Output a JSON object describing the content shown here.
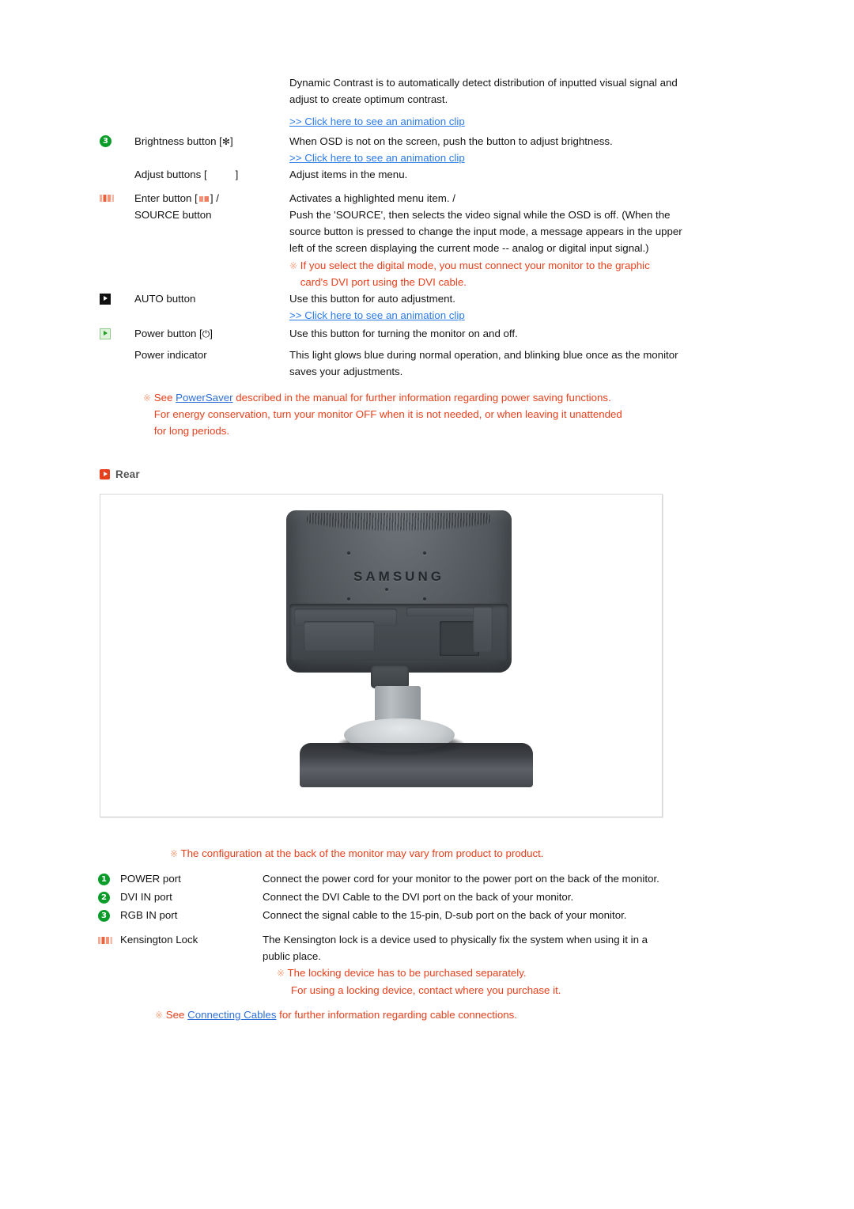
{
  "front_controls": {
    "dynamic_contrast_desc": "Dynamic Contrast is to automatically detect distribution of inputted visual signal and adjust to create optimum contrast.",
    "animation_link": ">> Click here to see an animation clip",
    "rows": [
      {
        "badge": "3",
        "badge_type": "green-circle",
        "name_prefix": "Brightness button [",
        "name_glyph": "✻",
        "name_suffix": "]",
        "desc": "When OSD is not on the screen, push the button to adjust brightness.",
        "link": ">> Click here to see an animation clip"
      },
      {
        "badge": "",
        "badge_type": "none",
        "name_prefix": "Adjust buttons [",
        "name_glyph": "",
        "name_suffix": "]",
        "desc": "Adjust items in the menu.",
        "link": ""
      },
      {
        "badge": "",
        "badge_type": "tiny-red",
        "name_prefix": "Enter button [",
        "name_glyph": "",
        "name_suffix": "] /",
        "name_line2": "SOURCE button",
        "desc": "Activates a highlighted menu item. /",
        "desc2": "Push the 'SOURCE', then selects the video signal while the OSD is off. (When the source button is pressed to change the input mode, a message appears in the upper left of the screen displaying the current mode -- analog or digital input signal.)",
        "note": "If you select the digital mode, you must connect your monitor to the graphic card's DVI port using the DVI cable.",
        "link": ""
      },
      {
        "badge": "",
        "badge_type": "black-square",
        "name_prefix": "AUTO button",
        "name_glyph": "",
        "name_suffix": "",
        "desc": "Use this button for auto adjustment.",
        "link": ">> Click here to see an animation clip"
      },
      {
        "badge": "",
        "badge_type": "green-square",
        "name_prefix": "Power button [",
        "name_glyph": "⏻",
        "name_suffix": "]",
        "desc": "Use this button for turning the monitor on and off.",
        "link": ""
      },
      {
        "badge": "",
        "badge_type": "none",
        "name_prefix": "Power indicator",
        "name_glyph": "",
        "name_suffix": "",
        "desc": "This light glows blue during normal operation, and blinking blue once as the monitor saves your adjustments.",
        "link": ""
      }
    ],
    "powersaver_note": {
      "mark": "※",
      "before": "See ",
      "link": "PowerSaver",
      "after": " described in the manual for further information regarding power saving functions. For energy conservation, turn your monitor OFF when it is not needed, or when leaving it unattended for long periods."
    }
  },
  "rear": {
    "heading": "Rear",
    "image_alt": "SAMSUNG monitor rear view",
    "brand": "SAMSUNG",
    "config_note": {
      "mark": "※",
      "text": "The configuration at the back of the monitor may vary from product to product."
    },
    "rows": [
      {
        "badge": "1",
        "badge_type": "green-circle",
        "name": "POWER port",
        "desc": "Connect the power cord for your monitor to the power port on the back of the monitor."
      },
      {
        "badge": "2",
        "badge_type": "green-circle",
        "name": "DVI IN port",
        "desc": "Connect the DVI Cable to the DVI port on the back of your monitor."
      },
      {
        "badge": "3",
        "badge_type": "green-circle",
        "name": "RGB IN port",
        "desc": "Connect the signal cable to the 15-pin, D-sub port on the back of your monitor."
      },
      {
        "badge": "",
        "badge_type": "tiny-red",
        "name": "Kensington Lock",
        "desc": "The Kensington lock is a device used to physically fix the system when using it in a public place."
      }
    ],
    "kensington_notes": {
      "mark": "※",
      "line1": "The locking device has to be purchased separately.",
      "line2": "For using a locking device, contact where you purchase it."
    },
    "cables_note": {
      "mark": "※",
      "before": "See ",
      "link": "Connecting Cables",
      "after": " for further information regarding cable connections."
    }
  },
  "colors": {
    "link_blue": "#2b7be8",
    "note_red": "#e8401c",
    "badge_green": "#0a9c28",
    "heading_gray": "#555555",
    "red_icon": "#e8401c"
  }
}
